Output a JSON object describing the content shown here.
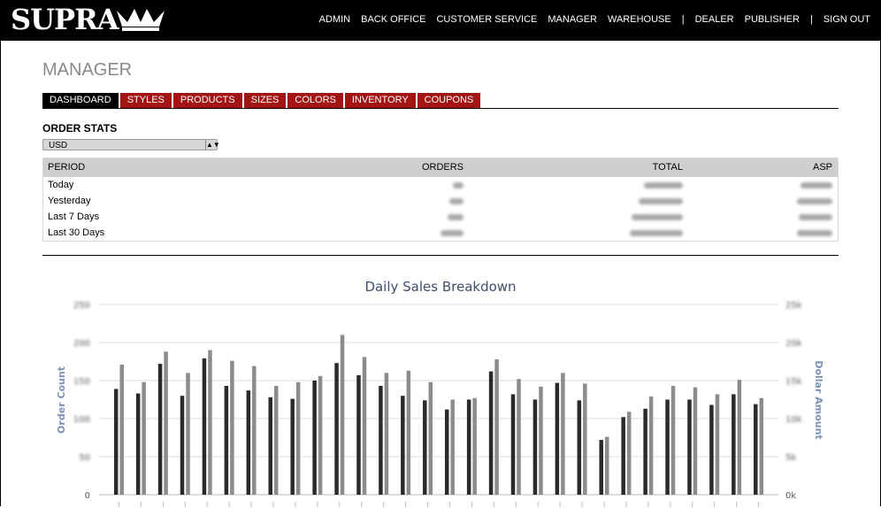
{
  "brand": {
    "logo_text": "SUPRA"
  },
  "nav": {
    "items": [
      "ADMIN",
      "BACK OFFICE",
      "CUSTOMER SERVICE",
      "MANAGER",
      "WAREHOUSE",
      "|",
      "DEALER",
      "PUBLISHER",
      "|",
      "SIGN OUT"
    ]
  },
  "page": {
    "title": "MANAGER"
  },
  "tabs": [
    "DASHBOARD",
    "STYLES",
    "PRODUCTS",
    "SIZES",
    "COLORS",
    "INVENTORY",
    "COUPONS"
  ],
  "order_stats": {
    "label": "ORDER STATS",
    "currency": "USD",
    "headers": [
      "PERIOD",
      "ORDERS",
      "TOTAL",
      "ASP"
    ],
    "rows": [
      {
        "period": "Today"
      },
      {
        "period": "Yesterday"
      },
      {
        "period": "Last 7 Days"
      },
      {
        "period": "Last 30 Days"
      }
    ]
  },
  "chart_data": {
    "type": "bar",
    "title": "Daily Sales Breakdown",
    "ylabel": "Order Count",
    "y2label": "Dollar Amount",
    "ylim": [
      0,
      250
    ],
    "y_ticks": [
      "0",
      "50",
      "100",
      "150",
      "200",
      "250"
    ],
    "y2_ticks": [
      "0k",
      "5k",
      "10k",
      "15k",
      "20k",
      "25k"
    ],
    "y_ticks_obscured": [
      false,
      true,
      true,
      true,
      true,
      true
    ],
    "y2_ticks_obscured": [
      false,
      true,
      true,
      true,
      true,
      true
    ],
    "series": [
      {
        "values": [
          139,
          133,
          172,
          130,
          179,
          143,
          137,
          128,
          126,
          150,
          173,
          157,
          143,
          130,
          124,
          112,
          125,
          162,
          132,
          125,
          147,
          124,
          72,
          102,
          113,
          125,
          125,
          118,
          132,
          119
        ]
      },
      {
        "values": [
          171,
          148,
          188,
          160,
          190,
          176,
          169,
          143,
          148,
          156,
          210,
          181,
          160,
          163,
          148,
          125,
          127,
          178,
          152,
          142,
          160,
          146,
          76,
          109,
          129,
          143,
          141,
          132,
          151,
          127
        ]
      }
    ],
    "colors": {
      "series1": "#2a2a2a",
      "series2": "#8c8c8c",
      "title": "#3d4f6b",
      "axis_label": "#7d93b3"
    }
  }
}
